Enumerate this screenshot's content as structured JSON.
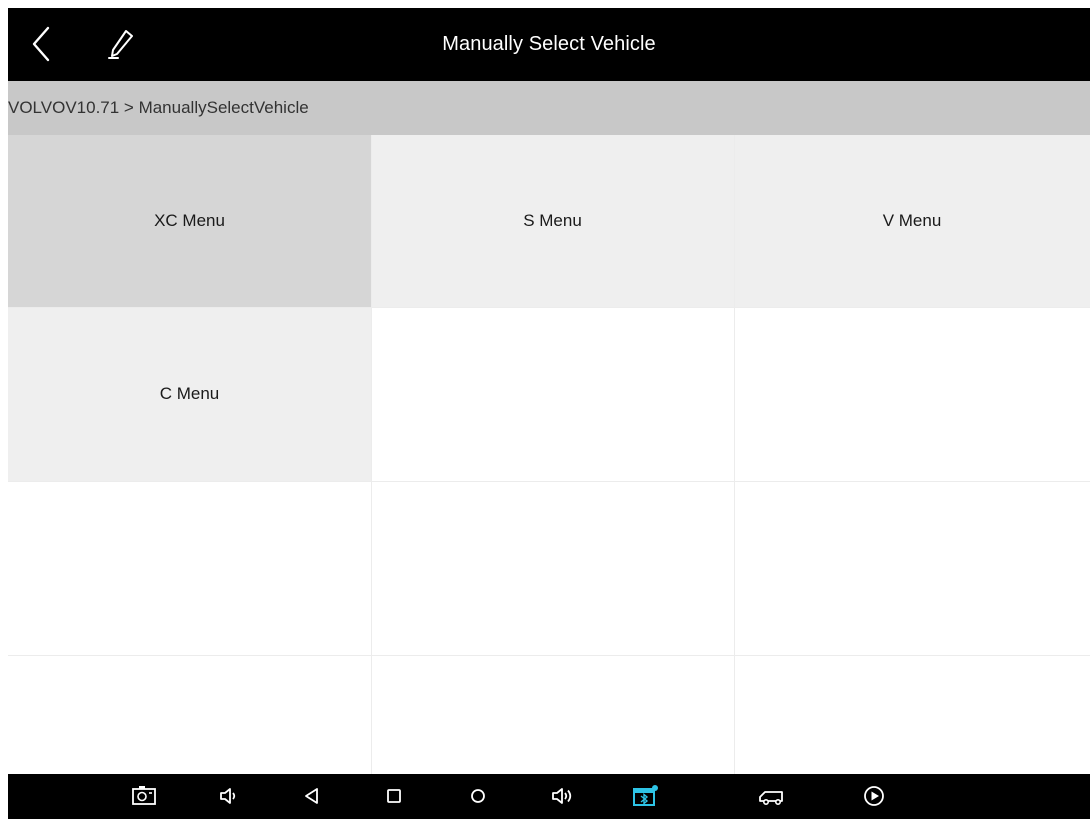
{
  "header": {
    "title": "Manually Select Vehicle",
    "back_icon": "chevron-left-icon",
    "edit_icon": "pen-icon"
  },
  "breadcrumb": {
    "text": "VOLVOV10.71 > ManuallySelectVehicle"
  },
  "menu": {
    "items": [
      {
        "label": "XC Menu",
        "selected": true
      },
      {
        "label": "S Menu",
        "selected": false
      },
      {
        "label": "V Menu",
        "selected": false
      },
      {
        "label": "C Menu",
        "selected": false
      }
    ]
  },
  "navbar": {
    "icons": [
      "screenshot-icon",
      "volume-down-icon",
      "back-triangle-icon",
      "recent-apps-icon",
      "home-icon",
      "volume-up-icon",
      "vci-bluetooth-icon",
      "vehicle-icon",
      "play-icon"
    ],
    "accent_color": "#2ec4e6"
  },
  "colors": {
    "topbar": "#000000",
    "breadcrumb_bg": "#c8c8c8",
    "cell_bg": "#efefef",
    "cell_selected_bg": "#d6d6d6"
  }
}
